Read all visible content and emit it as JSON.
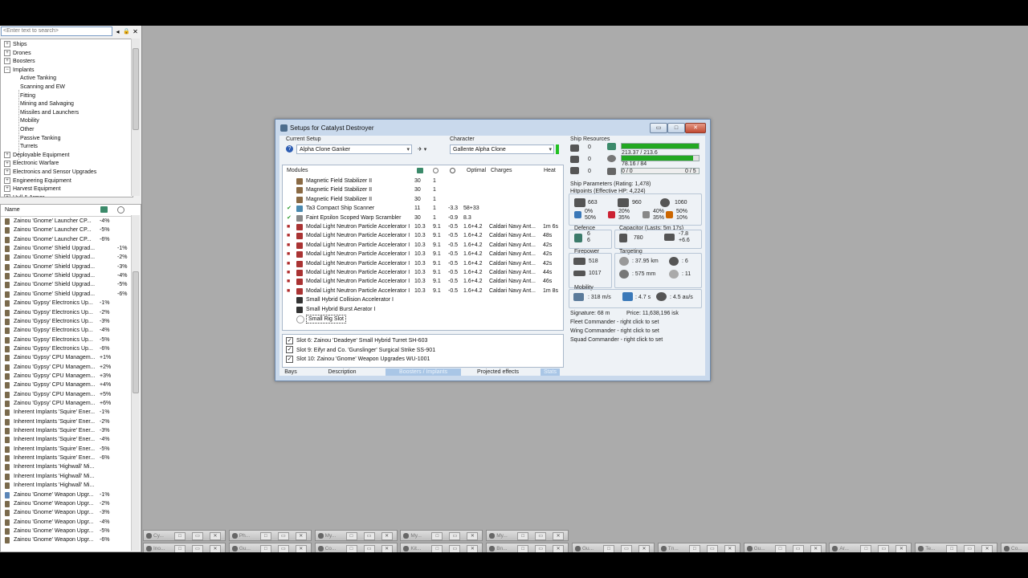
{
  "search": {
    "placeholder": "<Enter text to search>"
  },
  "search_buttons": [
    "◂",
    "🔒",
    "✕"
  ],
  "tree": {
    "top": [
      {
        "label": "Ships",
        "sign": "+"
      },
      {
        "label": "Drones",
        "sign": "+"
      },
      {
        "label": "Boosters",
        "sign": "+"
      },
      {
        "label": "Implants",
        "sign": "−"
      }
    ],
    "implant_children": [
      "Active Tanking",
      "Scanning and EW",
      "Fitting",
      "Mining and Salvaging",
      "Missiles and Launchers",
      "Mobility",
      "Other",
      "Passive Tanking",
      "Turrets"
    ],
    "bottom": [
      {
        "label": "Deployable Equipment",
        "sign": "+"
      },
      {
        "label": "Electronic Warfare",
        "sign": "+"
      },
      {
        "label": "Electronics and Sensor Upgrades",
        "sign": "+"
      },
      {
        "label": "Engineering Equipment",
        "sign": "+"
      },
      {
        "label": "Harvest Equipment",
        "sign": "+"
      },
      {
        "label": "Hull & Armor",
        "sign": "+"
      }
    ]
  },
  "list": {
    "header": "Name",
    "rows": [
      {
        "name": "Zainou 'Gnome' Launcher CP...",
        "v1": "-4%",
        "v2": ""
      },
      {
        "name": "Zainou 'Gnome' Launcher CP...",
        "v1": "-5%",
        "v2": ""
      },
      {
        "name": "Zainou 'Gnome' Launcher CP...",
        "v1": "-6%",
        "v2": ""
      },
      {
        "name": "Zainou 'Gnome' Shield Upgrad...",
        "v1": "",
        "v2": "-1%"
      },
      {
        "name": "Zainou 'Gnome' Shield Upgrad...",
        "v1": "",
        "v2": "-2%"
      },
      {
        "name": "Zainou 'Gnome' Shield Upgrad...",
        "v1": "",
        "v2": "-3%"
      },
      {
        "name": "Zainou 'Gnome' Shield Upgrad...",
        "v1": "",
        "v2": "-4%"
      },
      {
        "name": "Zainou 'Gnome' Shield Upgrad...",
        "v1": "",
        "v2": "-5%"
      },
      {
        "name": "Zainou 'Gnome' Shield Upgrad...",
        "v1": "",
        "v2": "-6%"
      },
      {
        "name": "Zainou 'Gypsy' Electronics Up...",
        "v1": "-1%",
        "v2": ""
      },
      {
        "name": "Zainou 'Gypsy' Electronics Up...",
        "v1": "-2%",
        "v2": ""
      },
      {
        "name": "Zainou 'Gypsy' Electronics Up...",
        "v1": "-3%",
        "v2": ""
      },
      {
        "name": "Zainou 'Gypsy' Electronics Up...",
        "v1": "-4%",
        "v2": ""
      },
      {
        "name": "Zainou 'Gypsy' Electronics Up...",
        "v1": "-5%",
        "v2": ""
      },
      {
        "name": "Zainou 'Gypsy' Electronics Up...",
        "v1": "-6%",
        "v2": ""
      },
      {
        "name": "Zainou 'Gypsy' CPU Managem...",
        "v1": "+1%",
        "v2": ""
      },
      {
        "name": "Zainou 'Gypsy' CPU Managem...",
        "v1": "+2%",
        "v2": ""
      },
      {
        "name": "Zainou 'Gypsy' CPU Managem...",
        "v1": "+3%",
        "v2": ""
      },
      {
        "name": "Zainou 'Gypsy' CPU Managem...",
        "v1": "+4%",
        "v2": ""
      },
      {
        "name": "Zainou 'Gypsy' CPU Managem...",
        "v1": "+5%",
        "v2": ""
      },
      {
        "name": "Zainou 'Gypsy' CPU Managem...",
        "v1": "+6%",
        "v2": ""
      },
      {
        "name": "Inherent Implants 'Squire' Ener...",
        "v1": "-1%",
        "v2": ""
      },
      {
        "name": "Inherent Implants 'Squire' Ener...",
        "v1": "-2%",
        "v2": ""
      },
      {
        "name": "Inherent Implants 'Squire' Ener...",
        "v1": "-3%",
        "v2": ""
      },
      {
        "name": "Inherent Implants 'Squire' Ener...",
        "v1": "-4%",
        "v2": ""
      },
      {
        "name": "Inherent Implants 'Squire' Ener...",
        "v1": "-5%",
        "v2": ""
      },
      {
        "name": "Inherent Implants 'Squire' Ener...",
        "v1": "-6%",
        "v2": ""
      },
      {
        "name": "Inherent Implants 'Highwall' Mi...",
        "v1": "",
        "v2": ""
      },
      {
        "name": "Inherent Implants 'Highwall' Mi...",
        "v1": "",
        "v2": ""
      },
      {
        "name": "Inherent Implants 'Highwall' Mi...",
        "v1": "",
        "v2": ""
      },
      {
        "name": "Zainou 'Gnome' Weapon Upgr...",
        "v1": "-1%",
        "v2": ""
      },
      {
        "name": "Zainou 'Gnome' Weapon Upgr...",
        "v1": "-2%",
        "v2": ""
      },
      {
        "name": "Zainou 'Gnome' Weapon Upgr...",
        "v1": "-3%",
        "v2": ""
      },
      {
        "name": "Zainou 'Gnome' Weapon Upgr...",
        "v1": "-4%",
        "v2": ""
      },
      {
        "name": "Zainou 'Gnome' Weapon Upgr...",
        "v1": "-5%",
        "v2": ""
      },
      {
        "name": "Zainou 'Gnome' Weapon Upgr...",
        "v1": "-6%",
        "v2": ""
      }
    ]
  },
  "dialog": {
    "title": "Setups for Catalyst Destroyer",
    "current_setup_label": "Current Setup",
    "current_setup_value": "Alpha Clone Ganker",
    "character_label": "Character",
    "character_value": "Gallente Alpha Clone",
    "modules_headers": {
      "modules": "Modules",
      "optimal": "Optimal",
      "charges": "Charges",
      "heat": "Heat"
    },
    "modules": [
      {
        "name": "Magnetic Field Stabilizer II",
        "c1": "30",
        "c2": "1",
        "c3": "",
        "optimal": "",
        "charges": "",
        "heat": "",
        "state": ""
      },
      {
        "name": "Magnetic Field Stabilizer II",
        "c1": "30",
        "c2": "1",
        "c3": "",
        "optimal": "",
        "charges": "",
        "heat": "",
        "state": ""
      },
      {
        "name": "Magnetic Field Stabilizer II",
        "c1": "30",
        "c2": "1",
        "c3": "",
        "optimal": "",
        "charges": "",
        "heat": "",
        "state": ""
      },
      {
        "name": "Ta3 Compact Ship Scanner",
        "c1": "11",
        "c2": "1",
        "c3": "-3.3",
        "optimal": "58+33",
        "charges": "",
        "heat": "",
        "state": "✔"
      },
      {
        "name": "Faint Epsilon Scoped Warp Scrambler",
        "c1": "30",
        "c2": "1",
        "c3": "-0.9",
        "optimal": "8.3",
        "charges": "",
        "heat": "",
        "state": "✔"
      },
      {
        "name": "Modal Light Neutron Particle Accelerator I",
        "c1": "10.3",
        "c2": "9.1",
        "c3": "-0.5",
        "optimal": "1.6+4.2",
        "charges": "Caldari Navy Ant...",
        "heat": "1m 6s",
        "state": "■"
      },
      {
        "name": "Modal Light Neutron Particle Accelerator I",
        "c1": "10.3",
        "c2": "9.1",
        "c3": "-0.5",
        "optimal": "1.6+4.2",
        "charges": "Caldari Navy Ant...",
        "heat": "48s",
        "state": "■"
      },
      {
        "name": "Modal Light Neutron Particle Accelerator I",
        "c1": "10.3",
        "c2": "9.1",
        "c3": "-0.5",
        "optimal": "1.6+4.2",
        "charges": "Caldari Navy Ant...",
        "heat": "42s",
        "state": "■"
      },
      {
        "name": "Modal Light Neutron Particle Accelerator I",
        "c1": "10.3",
        "c2": "9.1",
        "c3": "-0.5",
        "optimal": "1.6+4.2",
        "charges": "Caldari Navy Ant...",
        "heat": "42s",
        "state": "■"
      },
      {
        "name": "Modal Light Neutron Particle Accelerator I",
        "c1": "10.3",
        "c2": "9.1",
        "c3": "-0.5",
        "optimal": "1.6+4.2",
        "charges": "Caldari Navy Ant...",
        "heat": "42s",
        "state": "■"
      },
      {
        "name": "Modal Light Neutron Particle Accelerator I",
        "c1": "10.3",
        "c2": "9.1",
        "c3": "-0.5",
        "optimal": "1.6+4.2",
        "charges": "Caldari Navy Ant...",
        "heat": "44s",
        "state": "■"
      },
      {
        "name": "Modal Light Neutron Particle Accelerator I",
        "c1": "10.3",
        "c2": "9.1",
        "c3": "-0.5",
        "optimal": "1.6+4.2",
        "charges": "Caldari Navy Ant...",
        "heat": "46s",
        "state": "■"
      },
      {
        "name": "Modal Light Neutron Particle Accelerator I",
        "c1": "10.3",
        "c2": "9.1",
        "c3": "-0.5",
        "optimal": "1.6+4.2",
        "charges": "Caldari Navy Ant...",
        "heat": "1m 8s",
        "state": "■"
      },
      {
        "name": "Small Hybrid Collision Accelerator I",
        "c1": "",
        "c2": "",
        "c3": "",
        "optimal": "",
        "charges": "",
        "heat": "",
        "state": ""
      },
      {
        "name": "Small Hybrid Burst Aerator I",
        "c1": "",
        "c2": "",
        "c3": "",
        "optimal": "",
        "charges": "",
        "heat": "",
        "state": ""
      },
      {
        "name": "Small Rig Slot",
        "c1": "",
        "c2": "",
        "c3": "",
        "optimal": "",
        "charges": "",
        "heat": "",
        "state": ""
      }
    ],
    "implants": [
      "Slot 6: Zainou 'Deadeye' Small Hybrid Turret SH-603",
      "Slot 9: Eifyr and Co. 'Gunslinger' Surgical Strike SS-901",
      "Slot 10: Zainou 'Gnome' Weapon Upgrades WU-1001"
    ],
    "tabs": [
      "Bays",
      "Description",
      "Boosters / Implants",
      "Projected effects",
      "Stats"
    ],
    "tab_selected": [
      2,
      4
    ],
    "resources": {
      "label": "Ship Resources",
      "left_vals": [
        "0",
        "0",
        "0"
      ],
      "cpu": "213.37 / 213.6",
      "cpu_fraction": 0.999,
      "pg": "78.16 / 84",
      "pg_fraction": 0.93,
      "drone_left": "0 / 0",
      "drone_right": "0 / 5"
    },
    "params_label": "Ship Parameters (Rating: 1,478)",
    "hitpoints_label": "Hitpoints (Effective HP: 4,224)",
    "hp": [
      "663",
      "960",
      "1060"
    ],
    "resists": [
      {
        "a": "0%",
        "b": "50%"
      },
      {
        "a": "20%",
        "b": "35%"
      },
      {
        "a": "40%",
        "b": "35%"
      },
      {
        "a": "50%",
        "b": "10%"
      }
    ],
    "defence_label": "Defence",
    "defence_vals": [
      "6",
      "6"
    ],
    "capacitor_label": "Capacitor (Lasts: 5m 17s)",
    "cap_val": "780",
    "cap_delta": [
      "-7.8",
      "+6.6"
    ],
    "firepower_label": "Firepower",
    "firepower": [
      "518",
      "1017"
    ],
    "targeting_label": "Targeting",
    "targeting": [
      ": 37.95 km",
      ": 6",
      ": 575 mm",
      ": 11"
    ],
    "mobility_label": "Mobility",
    "mobility": [
      ": 318 m/s",
      ": 4.7 s",
      ": 4.5 au/s"
    ],
    "signature": "Signature: 68 m",
    "price": "Price: 11,638,196 isk",
    "commanders": [
      "Fleet Commander - right click to set",
      "Wing Commander - right click to set",
      "Squad Commander - right click to set"
    ]
  },
  "taskbar": {
    "row1": [
      "Cy...",
      "Ph...",
      "My...",
      "My...",
      "My..."
    ],
    "row2": [
      "Ino...",
      "Gu...",
      "Co...",
      "Kit...",
      "Bn...",
      "Gu...",
      "Tn...",
      "Gu...",
      "Ar...",
      "Te...",
      "Co...",
      "Sw..."
    ]
  },
  "colors": {
    "bar_green": "#22a822",
    "dialog_bg": "#c9d9ec",
    "close_red": "#c14a32"
  }
}
